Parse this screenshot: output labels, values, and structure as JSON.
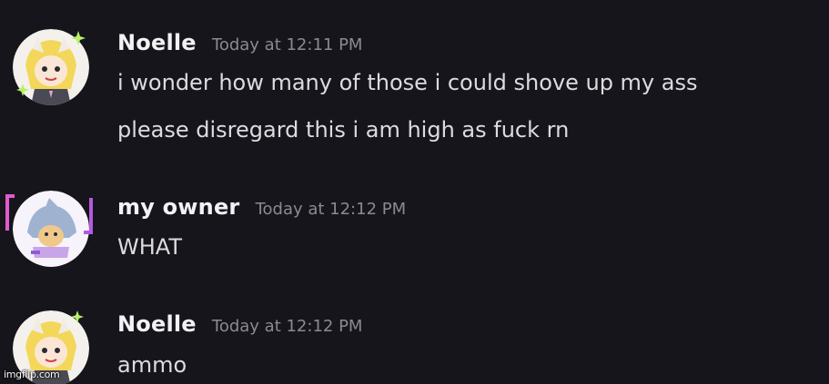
{
  "colors": {
    "background": "#16151b",
    "username": "#f2f2f5",
    "timestamp": "#8a8a93",
    "message": "#dcdcdf"
  },
  "messages": [
    {
      "username": "Noelle",
      "timestamp": "Today at 12:11 PM",
      "avatar_icon": "noelle-avatar-icon",
      "lines": [
        "i wonder how many of those i could shove up my ass",
        "please disregard this i am high as fuck rn"
      ]
    },
    {
      "username": "my owner",
      "timestamp": "Today at 12:12 PM",
      "avatar_icon": "shark-cat-avatar-icon",
      "lines": [
        "WHAT"
      ]
    },
    {
      "username": "Noelle",
      "timestamp": "Today at 12:12 PM",
      "avatar_icon": "noelle-avatar-icon",
      "lines": [
        "ammo"
      ]
    }
  ],
  "watermark": "imgflip.com"
}
